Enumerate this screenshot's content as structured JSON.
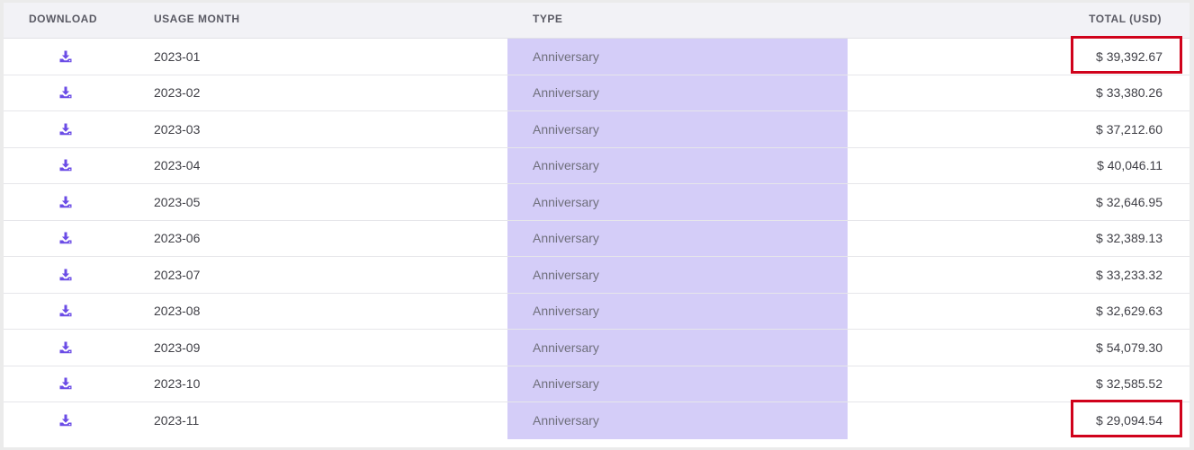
{
  "headers": {
    "download": "DOWNLOAD",
    "usage_month": "USAGE MONTH",
    "type": "TYPE",
    "total": "TOTAL (USD)"
  },
  "icon": "download-icon",
  "accent_color": "#6b4ce6",
  "type_highlight_color": "#d4cdf8",
  "annotation_color": "#d0021b",
  "rows": [
    {
      "month": "2023-01",
      "type": "Anniversary",
      "total": "$ 39,392.67",
      "highlighted": true
    },
    {
      "month": "2023-02",
      "type": "Anniversary",
      "total": "$ 33,380.26",
      "highlighted": false
    },
    {
      "month": "2023-03",
      "type": "Anniversary",
      "total": "$ 37,212.60",
      "highlighted": false
    },
    {
      "month": "2023-04",
      "type": "Anniversary",
      "total": "$ 40,046.11",
      "highlighted": false
    },
    {
      "month": "2023-05",
      "type": "Anniversary",
      "total": "$ 32,646.95",
      "highlighted": false
    },
    {
      "month": "2023-06",
      "type": "Anniversary",
      "total": "$ 32,389.13",
      "highlighted": false
    },
    {
      "month": "2023-07",
      "type": "Anniversary",
      "total": "$ 33,233.32",
      "highlighted": false
    },
    {
      "month": "2023-08",
      "type": "Anniversary",
      "total": "$ 32,629.63",
      "highlighted": false
    },
    {
      "month": "2023-09",
      "type": "Anniversary",
      "total": "$ 54,079.30",
      "highlighted": false
    },
    {
      "month": "2023-10",
      "type": "Anniversary",
      "total": "$ 32,585.52",
      "highlighted": false
    },
    {
      "month": "2023-11",
      "type": "Anniversary",
      "total": "$ 29,094.54",
      "highlighted": true
    }
  ]
}
